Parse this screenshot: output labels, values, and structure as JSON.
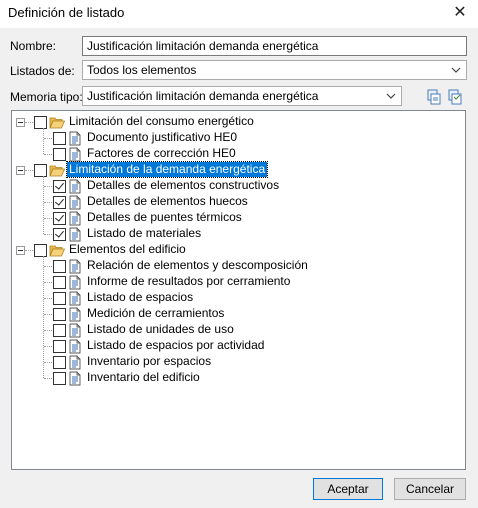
{
  "window": {
    "title": "Definición de listado",
    "close_glyph": "✕"
  },
  "form": {
    "nombre_label": "Nombre:",
    "nombre_value": "Justificación limitación demanda energética",
    "listados_label": "Listados de:",
    "listados_value": "Todos los elementos",
    "memoria_label": "Memoria tipo:",
    "memoria_value": "Justificación limitación demanda energética"
  },
  "tree": {
    "groups": [
      {
        "label": "Limitación del consumo energético",
        "checked": false,
        "selected": false,
        "items": [
          {
            "label": "Documento justificativo HE0",
            "checked": false
          },
          {
            "label": "Factores de corrección HE0",
            "checked": false
          }
        ]
      },
      {
        "label": "Limitación de la demanda energética",
        "checked": false,
        "selected": true,
        "items": [
          {
            "label": "Detalles de elementos constructivos",
            "checked": true
          },
          {
            "label": "Detalles de elementos huecos",
            "checked": true
          },
          {
            "label": "Detalles de puentes térmicos",
            "checked": true
          },
          {
            "label": "Listado de materiales",
            "checked": true
          }
        ]
      },
      {
        "label": "Elementos del edificio",
        "checked": false,
        "selected": false,
        "items": [
          {
            "label": "Relación de elementos y descomposición",
            "checked": false
          },
          {
            "label": "Informe de resultados por cerramiento",
            "checked": false
          },
          {
            "label": "Listado de espacios",
            "checked": false
          },
          {
            "label": "Medición de cerramientos",
            "checked": false
          },
          {
            "label": "Listado de unidades de uso",
            "checked": false
          },
          {
            "label": "Listado de espacios por actividad",
            "checked": false
          },
          {
            "label": "Inventario por espacios",
            "checked": false
          },
          {
            "label": "Inventario del edificio",
            "checked": false
          }
        ]
      }
    ]
  },
  "buttons": {
    "accept": "Aceptar",
    "cancel": "Cancelar"
  },
  "colors": {
    "selection": "#0078d7",
    "folder": "#e8b84a"
  }
}
